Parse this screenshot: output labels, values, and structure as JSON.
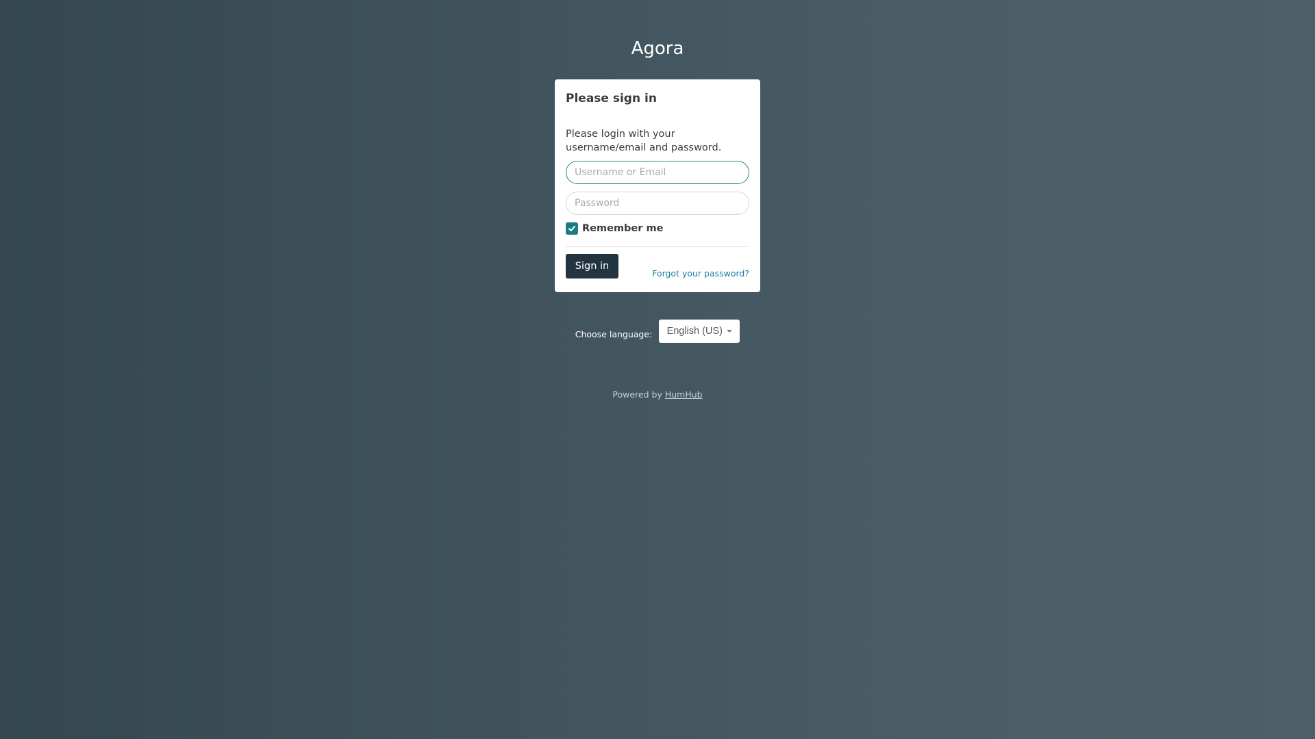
{
  "site": {
    "name": "Agora"
  },
  "login_panel": {
    "heading": "Please sign in",
    "intro": "Please login with your username/email and password.",
    "username_placeholder": "Username or Email",
    "password_placeholder": "Password",
    "remember_me_label": "Remember me",
    "remember_me_checked": true,
    "signin_label": "Sign in",
    "forgot_label": "Forgot your password?"
  },
  "language": {
    "label": "Choose language:",
    "selected": "English (US)"
  },
  "footer": {
    "powered_prefix": "Powered by",
    "powered_link": "HumHub"
  },
  "colors": {
    "accent": "#1a7b83",
    "button_dark": "#223440",
    "link": "#1a7fa6",
    "focus_border": "#2a8585"
  },
  "icons": {
    "checkbox": "check-icon",
    "dropdown": "caret-down-icon"
  }
}
